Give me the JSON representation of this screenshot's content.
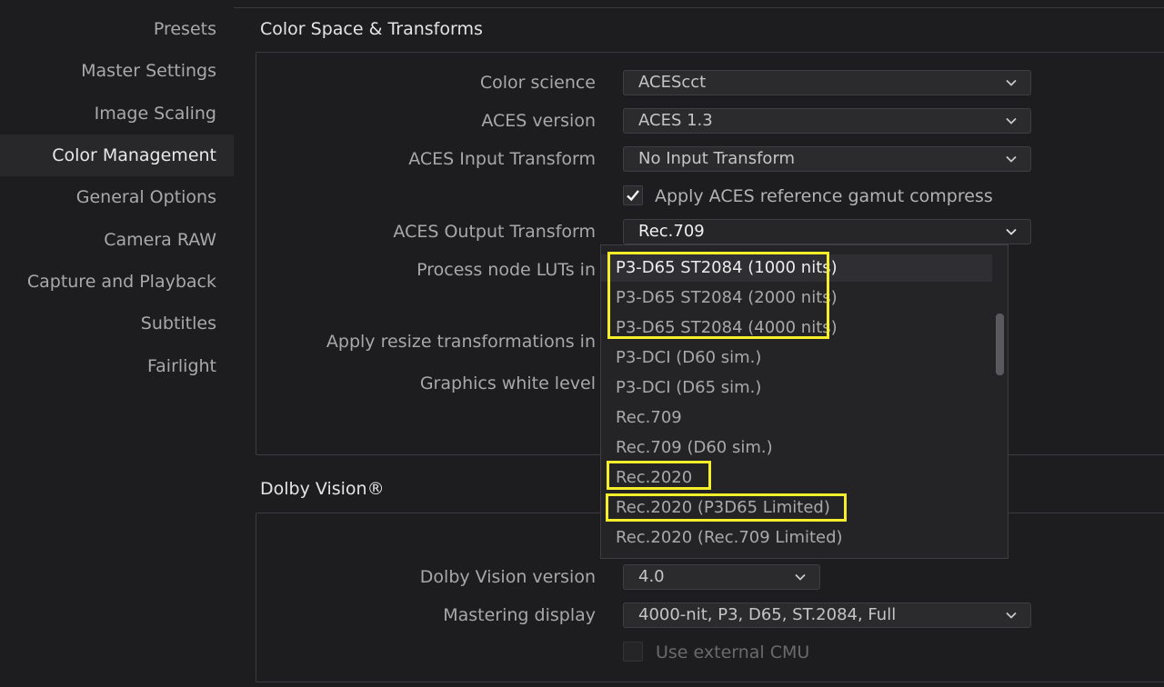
{
  "sidebar": {
    "items": [
      {
        "label": "Presets"
      },
      {
        "label": "Master Settings"
      },
      {
        "label": "Image Scaling"
      },
      {
        "label": "Color Management"
      },
      {
        "label": "General Options"
      },
      {
        "label": "Camera RAW"
      },
      {
        "label": "Capture and Playback"
      },
      {
        "label": "Subtitles"
      },
      {
        "label": "Fairlight"
      }
    ],
    "active": "Color Management"
  },
  "color_space": {
    "title": "Color Space & Transforms",
    "color_science": {
      "label": "Color science",
      "value": "ACEScct"
    },
    "aces_version": {
      "label": "ACES version",
      "value": "ACES 1.3"
    },
    "aces_input": {
      "label": "ACES Input Transform",
      "value": "No Input Transform"
    },
    "gamut_compress": {
      "label": "Apply ACES reference gamut compress",
      "checked": true
    },
    "aces_output": {
      "label": "ACES Output Transform",
      "value": "Rec.709"
    },
    "process_luts": {
      "label": "Process node LUTs in"
    },
    "resize": {
      "label": "Apply resize transformations in"
    },
    "graphics_white": {
      "label": "Graphics white level"
    }
  },
  "output_dropdown": {
    "items": [
      "P3-D65 ST2084 (1000 nits)",
      "P3-D65 ST2084 (2000 nits)",
      "P3-D65 ST2084 (4000 nits)",
      "P3-DCI (D60 sim.)",
      "P3-DCI (D65 sim.)",
      "Rec.709",
      "Rec.709 (D60 sim.)",
      "Rec.2020",
      "Rec.2020 (P3D65 Limited)",
      "Rec.2020 (Rec.709 Limited)"
    ],
    "hovered": "P3-D65 ST2084 (1000 nits)",
    "highlight_color": "#f5ee2a"
  },
  "dolby": {
    "title": "Dolby Vision®",
    "version": {
      "label": "Dolby Vision version",
      "value": "4.0"
    },
    "mastering": {
      "label": "Mastering display",
      "value": "4000-nit, P3, D65, ST.2084, Full"
    },
    "external_cmu": {
      "label": "Use external CMU",
      "checked": false
    }
  }
}
